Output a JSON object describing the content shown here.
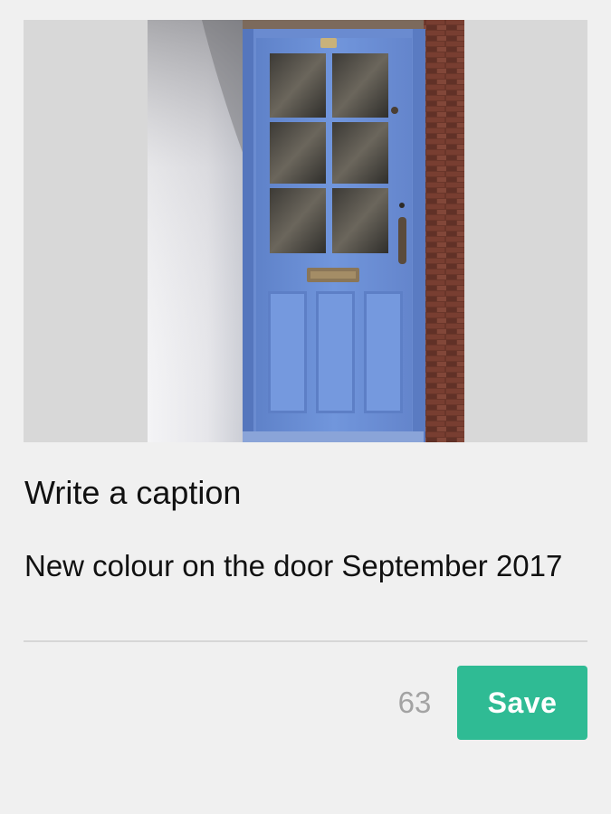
{
  "photo": {
    "subject": "blue-front-door-photo",
    "door_color": "#6d8fd6",
    "frame_color": "#d8d8d8"
  },
  "caption_form": {
    "heading": "Write a caption",
    "caption_value": "New colour on the door September 2017",
    "remaining_characters": "63",
    "save_label": "Save",
    "accent_color": "#2fbb94"
  }
}
